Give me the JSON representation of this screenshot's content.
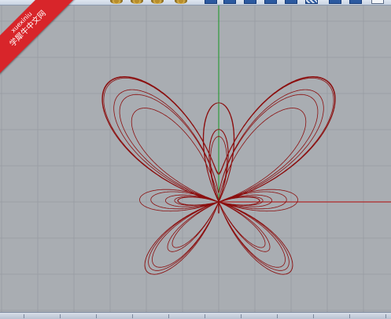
{
  "toolbar": {
    "buttons": [
      {
        "icon": "mark-icon"
      },
      {
        "icon": "gear-icon"
      },
      {
        "icon": "gear-icon"
      },
      {
        "icon": "gear-icon"
      },
      {
        "icon": "gear-icon"
      },
      {
        "icon": "viewport-layout-icon"
      },
      {
        "icon": "viewport-layout-icon"
      },
      {
        "icon": "viewport-layout-icon"
      },
      {
        "icon": "viewport-layout-icon"
      },
      {
        "icon": "viewport-layout-icon"
      },
      {
        "icon": "hatched-viewport-icon"
      },
      {
        "icon": "viewport-layout-icon"
      },
      {
        "icon": "viewport-layout-icon"
      },
      {
        "icon": "white-panel-icon"
      }
    ]
  },
  "watermark": {
    "site": "xuexiniu",
    "name": "学犀牛中文网",
    "color": "#d8252a"
  },
  "viewport": {
    "background": "#a9adb2",
    "grid_color": "#9a9fa5",
    "x_axis_color": "#b02a2a",
    "y_axis_color": "#2f9a3a",
    "curve_color": "#8b0e0e",
    "curve": "butterfly-curve"
  }
}
